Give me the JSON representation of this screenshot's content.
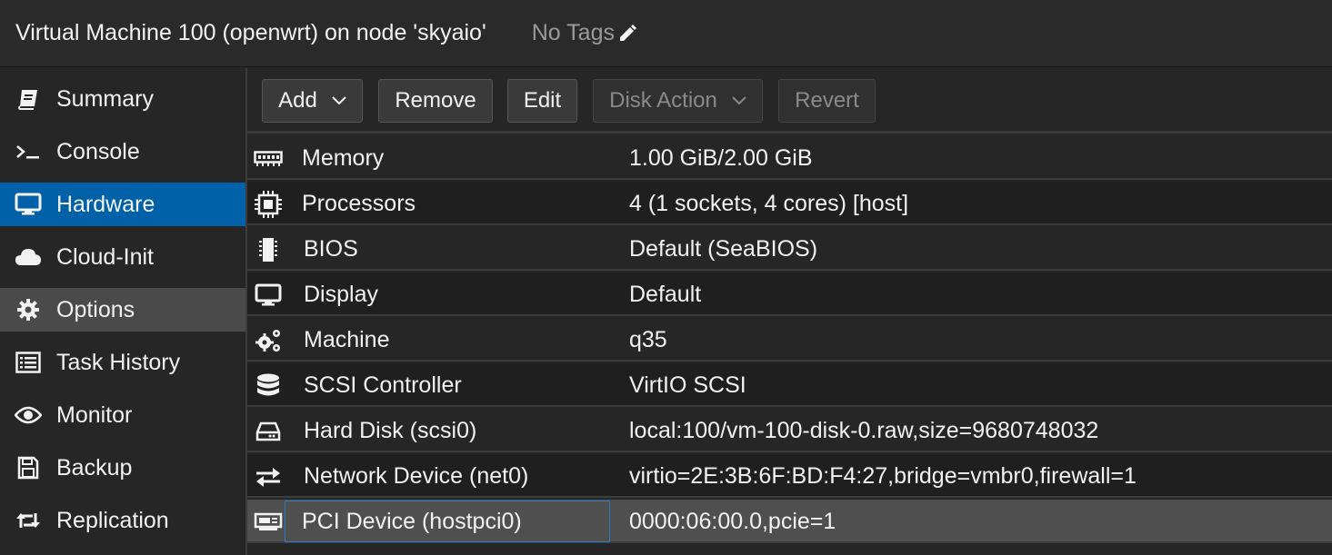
{
  "header": {
    "title": "Virtual Machine 100 (openwrt) on node 'skyaio'",
    "tags": "No Tags"
  },
  "sidebar": {
    "items": [
      {
        "label": "Summary",
        "icon": "book-icon"
      },
      {
        "label": "Console",
        "icon": "terminal-icon"
      },
      {
        "label": "Hardware",
        "icon": "desktop-icon",
        "state": "active"
      },
      {
        "label": "Cloud-Init",
        "icon": "cloud-icon"
      },
      {
        "label": "Options",
        "icon": "gear-icon",
        "state": "hover"
      },
      {
        "label": "Task History",
        "icon": "list-icon"
      },
      {
        "label": "Monitor",
        "icon": "eye-icon"
      },
      {
        "label": "Backup",
        "icon": "floppy-icon"
      },
      {
        "label": "Replication",
        "icon": "retweet-icon"
      }
    ]
  },
  "toolbar": {
    "add": "Add",
    "remove": "Remove",
    "edit": "Edit",
    "disk_action": "Disk Action",
    "revert": "Revert"
  },
  "hardware": {
    "rows": [
      {
        "name": "Memory",
        "value": "1.00 GiB/2.00 GiB",
        "icon": "memory-icon"
      },
      {
        "name": "Processors",
        "value": "4 (1 sockets, 4 cores) [host]",
        "icon": "cpu-icon"
      },
      {
        "name": "BIOS",
        "value": "Default (SeaBIOS)",
        "icon": "microchip-icon"
      },
      {
        "name": "Display",
        "value": "Default",
        "icon": "desktop-icon"
      },
      {
        "name": "Machine",
        "value": "q35",
        "icon": "cogs-icon"
      },
      {
        "name": "SCSI Controller",
        "value": "VirtIO SCSI",
        "icon": "database-icon"
      },
      {
        "name": "Hard Disk (scsi0)",
        "value": "local:100/vm-100-disk-0.raw,size=9680748032",
        "icon": "hdd-icon"
      },
      {
        "name": "Network Device (net0)",
        "value": "virtio=2E:3B:6F:BD:F4:27,bridge=vmbr0,firewall=1",
        "icon": "exchange-icon"
      },
      {
        "name": "PCI Device (hostpci0)",
        "value": "0000:06:00.0,pcie=1",
        "icon": "pci-card-icon",
        "state": "selected"
      }
    ]
  },
  "colors": {
    "accent": "#0061a8",
    "background": "#262626",
    "selected_row": "#4f4f4f"
  }
}
